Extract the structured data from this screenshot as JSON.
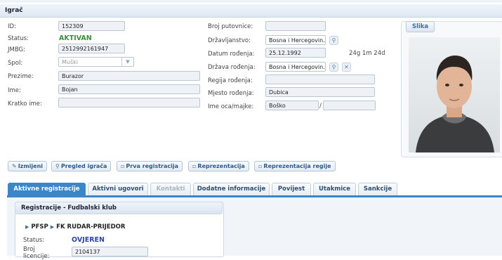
{
  "panel": {
    "title": "Igrač"
  },
  "left": {
    "id_label": "ID:",
    "id_value": "152309",
    "status_label": "Status:",
    "status_value": "AKTIVAN",
    "jmbg_label": "JMBG:",
    "jmbg_value": "2512992161947",
    "spol_label": "Spol:",
    "spol_value": "Muški",
    "prezime_label": "Prezime:",
    "prezime_value": "Burazor",
    "ime_label": "Ime:",
    "ime_value": "Bojan",
    "kratko_label": "Kratko ime:",
    "kratko_value": ""
  },
  "middle": {
    "putovnica_label": "Broj putovnice:",
    "putovnica_value": "",
    "drzavljanstvo_label": "Državljanstvo:",
    "drzavljanstvo_value": "Bosna i Hercegovin...",
    "datum_label": "Datum rođenja:",
    "datum_value": "25.12.1992",
    "age": "24g 1m 24d",
    "drzava_label": "Država rođenja:",
    "drzava_value": "Bosna i Hercegovin...",
    "regija_label": "Regija rođenja:",
    "regija_value": "",
    "mjesto_label": "Mjesto rođenja:",
    "mjesto_value": "Dubica",
    "roditelj_label": "Ime oca/majke:",
    "otac_value": "Boško",
    "separator": "/",
    "majka_value": ""
  },
  "photo": {
    "tab_label": "Slika"
  },
  "actions": [
    {
      "label": "Izmijeni",
      "icon": "pencil-icon",
      "glyph": "✎"
    },
    {
      "label": "Pregled igrača",
      "icon": "search-icon",
      "glyph": "⚲"
    },
    {
      "label": "Prva registracija",
      "icon": "document-icon",
      "glyph": "▫"
    },
    {
      "label": "Reprezentacija",
      "icon": "document-icon",
      "glyph": "▫"
    },
    {
      "label": "Reprezentacija regije",
      "icon": "document-icon",
      "glyph": "▫"
    }
  ],
  "tabs": [
    {
      "label": "Aktivne registracije",
      "state": "active"
    },
    {
      "label": "Aktivni ugovori",
      "state": "normal"
    },
    {
      "label": "Kontakti",
      "state": "disabled"
    },
    {
      "label": "Dodatne informacije",
      "state": "normal"
    },
    {
      "label": "Povijest",
      "state": "normal"
    },
    {
      "label": "Utakmice",
      "state": "normal"
    },
    {
      "label": "Sankcije",
      "state": "normal"
    }
  ],
  "registration": {
    "title": "Registracije - Fudbalski klub",
    "federation": "PFSP",
    "club": "FK RUDAR-PRIJEDOR",
    "status_label": "Status:",
    "status_value": "OVJEREN",
    "licence_label": "Broj licencije:",
    "licence_value": "2104137"
  },
  "colors": {
    "accent": "#3b86c8",
    "status_green": "#3a8f3a",
    "status_blue": "#2a46a0"
  }
}
